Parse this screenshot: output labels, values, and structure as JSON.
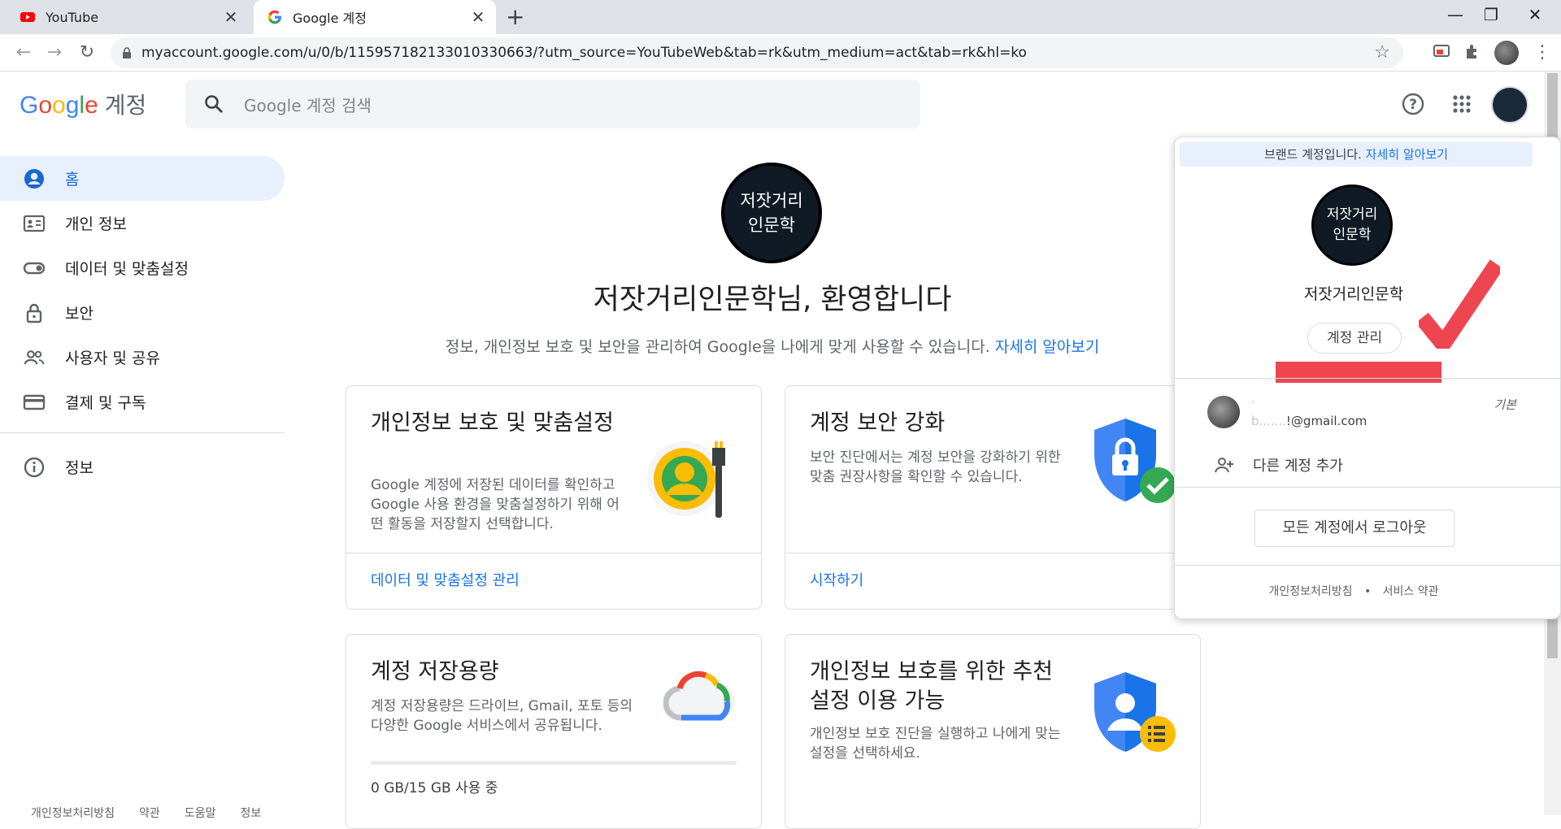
{
  "browser": {
    "tabs": [
      {
        "title": "YouTube",
        "close": "✕",
        "active": false
      },
      {
        "title": "Google 계정",
        "close": "✕",
        "active": true
      }
    ],
    "new_tab": "+",
    "window_controls": {
      "minimize": "—",
      "maximize": "❐",
      "close": "✕"
    },
    "url": "myaccount.google.com/u/0/b/115957182133010330663/?utm_source=YouTubeWeb&tab=rk&utm_medium=act&tab=rk&hl=ko",
    "nav": {
      "back": "←",
      "forward": "→",
      "reload": "↻"
    },
    "icons": [
      "lock-icon",
      "star-icon",
      "cast-icon",
      "extensions-icon",
      "profile-avatar",
      "menu-icon"
    ]
  },
  "header": {
    "logo": {
      "G": "G",
      "o1": "o",
      "o2": "o",
      "g": "g",
      "l": "l",
      "e": "e",
      "suffix": "계정"
    },
    "search_placeholder": "Google 계정 검색",
    "icons": [
      "help-icon",
      "apps-grid-icon",
      "account-avatar"
    ]
  },
  "sidebar": {
    "items": [
      {
        "label": "홈",
        "icon": "home-account-icon",
        "selected": true
      },
      {
        "label": "개인 정보",
        "icon": "id-card-icon",
        "selected": false
      },
      {
        "label": "데이터 및 맞춤설정",
        "icon": "toggle-icon",
        "selected": false
      },
      {
        "label": "보안",
        "icon": "lock-icon",
        "selected": false
      },
      {
        "label": "사용자 및 공유",
        "icon": "people-icon",
        "selected": false
      },
      {
        "label": "결제 및 구독",
        "icon": "credit-card-icon",
        "selected": false
      }
    ],
    "secondary": [
      {
        "label": "정보",
        "icon": "info-icon"
      }
    ],
    "footer": [
      "개인정보처리방침",
      "약관",
      "도움말",
      "정보"
    ]
  },
  "main": {
    "avatar_text": {
      "line1": "저잣거리",
      "line2": "인문학"
    },
    "welcome": "저잣거리인문학님, 환영합니다",
    "subtitle": "정보, 개인정보 보호 및 보안을 관리하여 Google을 나에게 맞게 사용할 수 있습니다.",
    "subtitle_link": "자세히 알아보기",
    "cards": [
      {
        "title": "개인정보 보호 및 맞춤설정",
        "desc": "Google 계정에 저장된 데이터를 확인하고 Google 사용 환경을 맞춤설정하기 위해 어떤 활동을 저장할지 선택합니다.",
        "link": "데이터 및 맞춤설정 관리",
        "icon": "privacy-personalization-icon"
      },
      {
        "title": "계정 보안 강화",
        "desc": "보안 진단에서는 계정 보안을 강화하기 위한 맞춤 권장사항을 확인할 수 있습니다.",
        "link": "시작하기",
        "icon": "security-shield-icon"
      },
      {
        "title": "계정 저장용량",
        "desc": "계정 저장용량은 드라이브, Gmail, 포토 등의 다양한 Google 서비스에서 공유됩니다.",
        "usage": "0 GB/15 GB 사용 중",
        "usage_fraction": 0.0,
        "icon": "cloud-storage-icon"
      },
      {
        "title": "개인정보 보호를 위한 추천 설정 이용 가능",
        "desc": "개인정보 보호 진단을 실행하고 나에게 맞는 설정을 선택하세요.",
        "icon": "privacy-checkup-icon"
      }
    ]
  },
  "popup": {
    "brand_text": "브랜드 계정입니다.",
    "brand_link": "자세히 알아보기",
    "avatar_text": {
      "line1": "저잣거리",
      "line2": "인문학"
    },
    "name": "저잣거리인문학",
    "manage_button": "계정 관리",
    "account": {
      "name": "·",
      "email_hidden": "b.......",
      "email_visible": "!@gmail.com",
      "default_label": "기본"
    },
    "add_account": "다른 계정 추가",
    "signout": "모든 계정에서 로그아웃",
    "footer": {
      "privacy": "개인정보처리방침",
      "sep": "•",
      "terms": "서비스 약관"
    }
  },
  "colors": {
    "accent": "#1a73e8",
    "selected_bg": "#e8f0fe",
    "redact": "#ed4650"
  }
}
